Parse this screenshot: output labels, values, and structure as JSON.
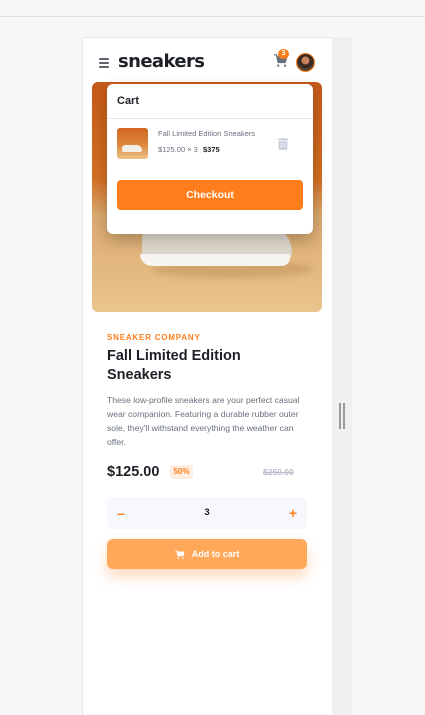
{
  "header": {
    "logo": "sneakers",
    "cart_count": "3"
  },
  "cart": {
    "title": "Cart",
    "item": {
      "name": "Fall Limited Edition Sneakers",
      "unit_price_qty": "$125.00 × 3",
      "total": "$375"
    },
    "checkout_label": "Checkout"
  },
  "product": {
    "company": "SNEAKER COMPANY",
    "title": "Fall Limited Edition Sneakers",
    "description": "These low-profile sneakers are your perfect casual wear companion. Featuring a durable rubber outer sole, they'll withstand everything the weather can offer.",
    "price": "$125.00",
    "discount": "50%",
    "old_price": "$250.00"
  },
  "quantity": {
    "value": "3",
    "minus": "–",
    "plus": "+"
  },
  "actions": {
    "add_to_cart": "Add to cart"
  },
  "colors": {
    "accent": "#ff7e1b",
    "accent_pale": "#ffede0",
    "dark_text": "#1d2026",
    "muted_text": "#68707d"
  },
  "icons": [
    "menu-icon",
    "cart-icon",
    "trash-icon"
  ]
}
